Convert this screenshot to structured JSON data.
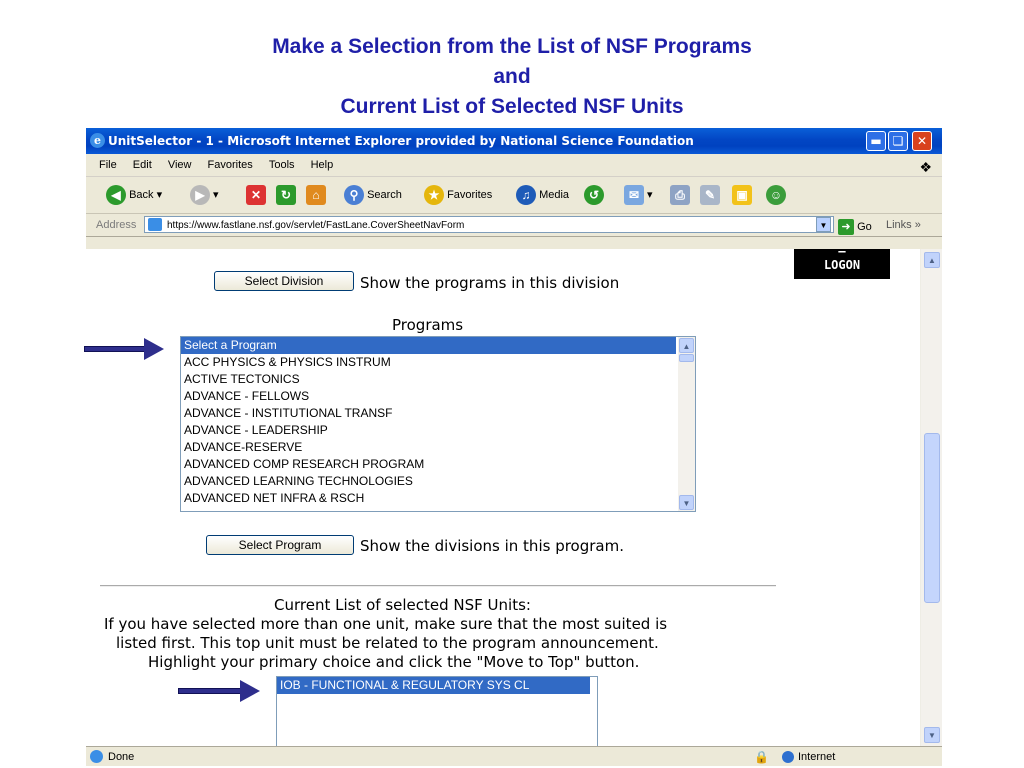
{
  "slide": {
    "title_line1": "Make a Selection from the List of NSF Programs",
    "title_line2": "and",
    "title_line3": "Current List of Selected NSF Units"
  },
  "window": {
    "title": "UnitSelector - 1 - Microsoft Internet Explorer provided by National Science Foundation",
    "controls": [
      "minimize",
      "maximize",
      "close"
    ]
  },
  "menu": [
    "File",
    "Edit",
    "View",
    "Favorites",
    "Tools",
    "Help"
  ],
  "toolbar": {
    "back": "Back",
    "search": "Search",
    "favorites": "Favorites",
    "media": "Media"
  },
  "address": {
    "label": "Address",
    "url": "https://www.fastlane.nsf.gov/servlet/FastLane.CoverSheetNavForm",
    "go": "Go",
    "links": "Links"
  },
  "page": {
    "logon_label": "LOGON",
    "select_division_button": "Select Division",
    "select_division_hint": "Show the programs in this division",
    "programs_heading": "Programs",
    "programs": [
      "Select a Program",
      "ACC PHYSICS & PHYSICS INSTRUM",
      "ACTIVE TECTONICS",
      "ADVANCE - FELLOWS",
      "ADVANCE - INSTITUTIONAL TRANSF",
      "ADVANCE - LEADERSHIP",
      "ADVANCE-RESERVE",
      "ADVANCED COMP RESEARCH PROGRAM",
      "ADVANCED LEARNING TECHNOLOGIES",
      "ADVANCED NET INFRA & RSCH"
    ],
    "selected_program": "Select a Program",
    "select_program_button": "Select Program",
    "select_program_hint": "Show the divisions in this program.",
    "units_heading": "Current List of selected NSF Units:",
    "units_instructions": [
      "If you have selected more than one unit, make sure that the most suited is",
      "listed first.  This top unit must be related to the program announcement.",
      "Highlight your primary choice and click the \"Move to Top\" button."
    ],
    "units": [
      "IOB - FUNCTIONAL & REGULATORY SYS CL"
    ]
  },
  "status": {
    "text": "Done",
    "zone": "Internet"
  },
  "colors": {
    "title": "#1f1fa8",
    "titlebar": "#0246c4",
    "selection": "#316ac5",
    "arrow": "#2e2e8c"
  }
}
